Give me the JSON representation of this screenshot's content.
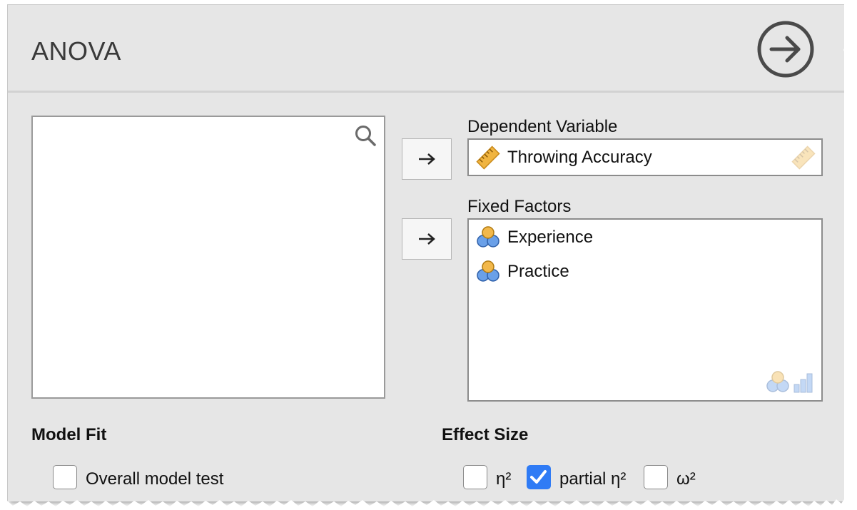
{
  "header": {
    "title": "ANOVA",
    "run_icon": "arrow-circle-right-icon"
  },
  "source_list": {
    "search_icon": "search-icon",
    "items": []
  },
  "dependent_variable": {
    "label": "Dependent Variable",
    "value": "Throwing Accuracy",
    "value_icon": "ruler-icon",
    "hint_icon": "ruler-icon"
  },
  "fixed_factors": {
    "label": "Fixed Factors",
    "items": [
      {
        "label": "Experience",
        "icon": "nominal-variable-icon"
      },
      {
        "label": "Practice",
        "icon": "nominal-variable-icon"
      }
    ],
    "hint_icons": [
      "nominal-variable-icon",
      "ordinal-variable-icon"
    ]
  },
  "model_fit": {
    "title": "Model Fit",
    "options": [
      {
        "label": "Overall model test",
        "checked": false
      }
    ]
  },
  "effect_size": {
    "title": "Effect Size",
    "options": [
      {
        "label": "η²",
        "checked": false
      },
      {
        "label": "partial η²",
        "checked": true
      },
      {
        "label": "ω²",
        "checked": false
      }
    ]
  },
  "colors": {
    "panel_bg": "#e6e6e6",
    "checkbox_checked": "#2f7bf5",
    "ruler": "#f0b440",
    "factor_blue": "#6aa0e8",
    "factor_orange": "#f2b84b"
  }
}
